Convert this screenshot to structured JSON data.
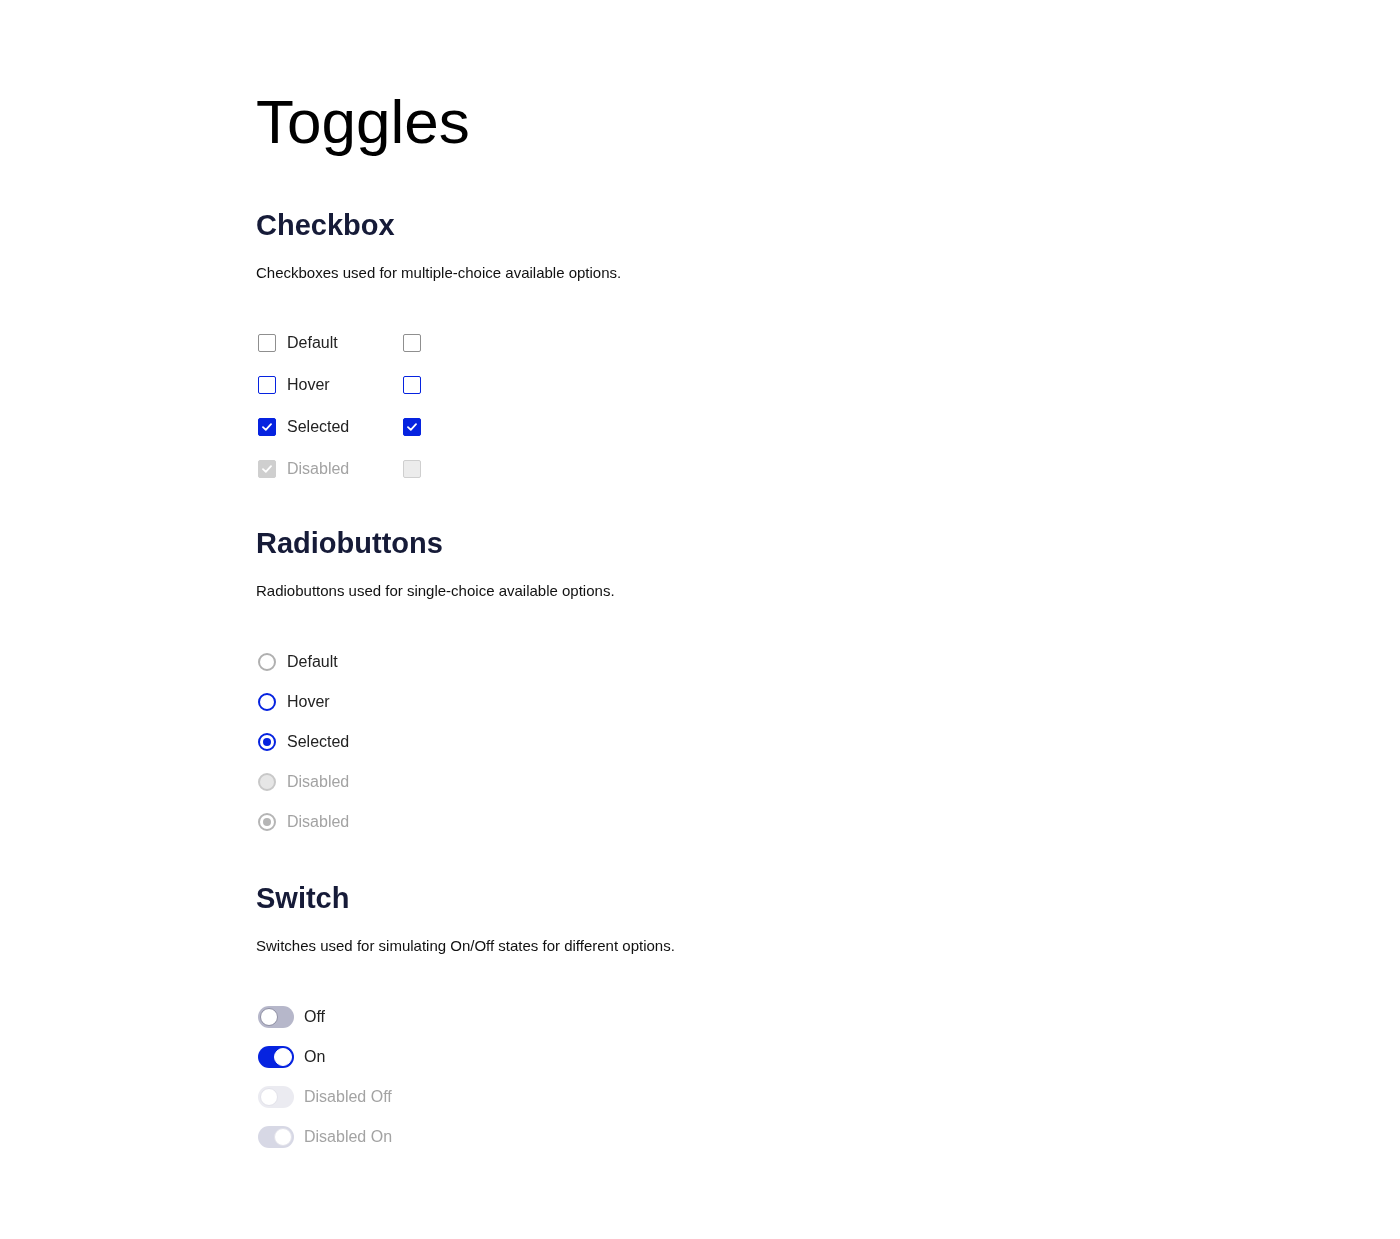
{
  "page": {
    "title": "Toggles"
  },
  "checkbox": {
    "heading": "Checkbox",
    "description": "Checkboxes used for multiple-choice available options.",
    "rows": [
      {
        "kind": "default",
        "boxes": [
          {
            "label": "Default",
            "checked": false
          },
          {
            "checked": false
          }
        ]
      },
      {
        "kind": "hover",
        "boxes": [
          {
            "label": "Hover",
            "checked": false
          },
          {
            "checked": false
          }
        ]
      },
      {
        "kind": "default",
        "boxes": [
          {
            "label": "Selected",
            "checked": true
          },
          {
            "checked": true
          }
        ]
      },
      {
        "kind": "disabled",
        "boxes": [
          {
            "label": "Disabled",
            "checked": true
          },
          {
            "checked": false
          }
        ]
      }
    ]
  },
  "radiobuttons": {
    "heading": "Radiobuttons",
    "description": "Radiobuttons used for single-choice available options.",
    "items": [
      {
        "kind": "default",
        "label": "Default",
        "selected": false
      },
      {
        "kind": "hover",
        "label": "Hover",
        "selected": false
      },
      {
        "kind": "default",
        "label": "Selected",
        "selected": true
      },
      {
        "kind": "disabled",
        "label": "Disabled",
        "selected": false
      },
      {
        "kind": "disabled",
        "label": "Disabled",
        "selected": true
      }
    ]
  },
  "switch": {
    "heading": "Switch",
    "description": "Switches used for simulating On/Off states for different options.",
    "items": [
      {
        "label": "Off",
        "on": false,
        "disabled": false
      },
      {
        "label": "On",
        "on": true,
        "disabled": false
      },
      {
        "label": "Disabled Off",
        "on": false,
        "disabled": true
      },
      {
        "label": "Disabled On",
        "on": true,
        "disabled": true
      }
    ]
  }
}
